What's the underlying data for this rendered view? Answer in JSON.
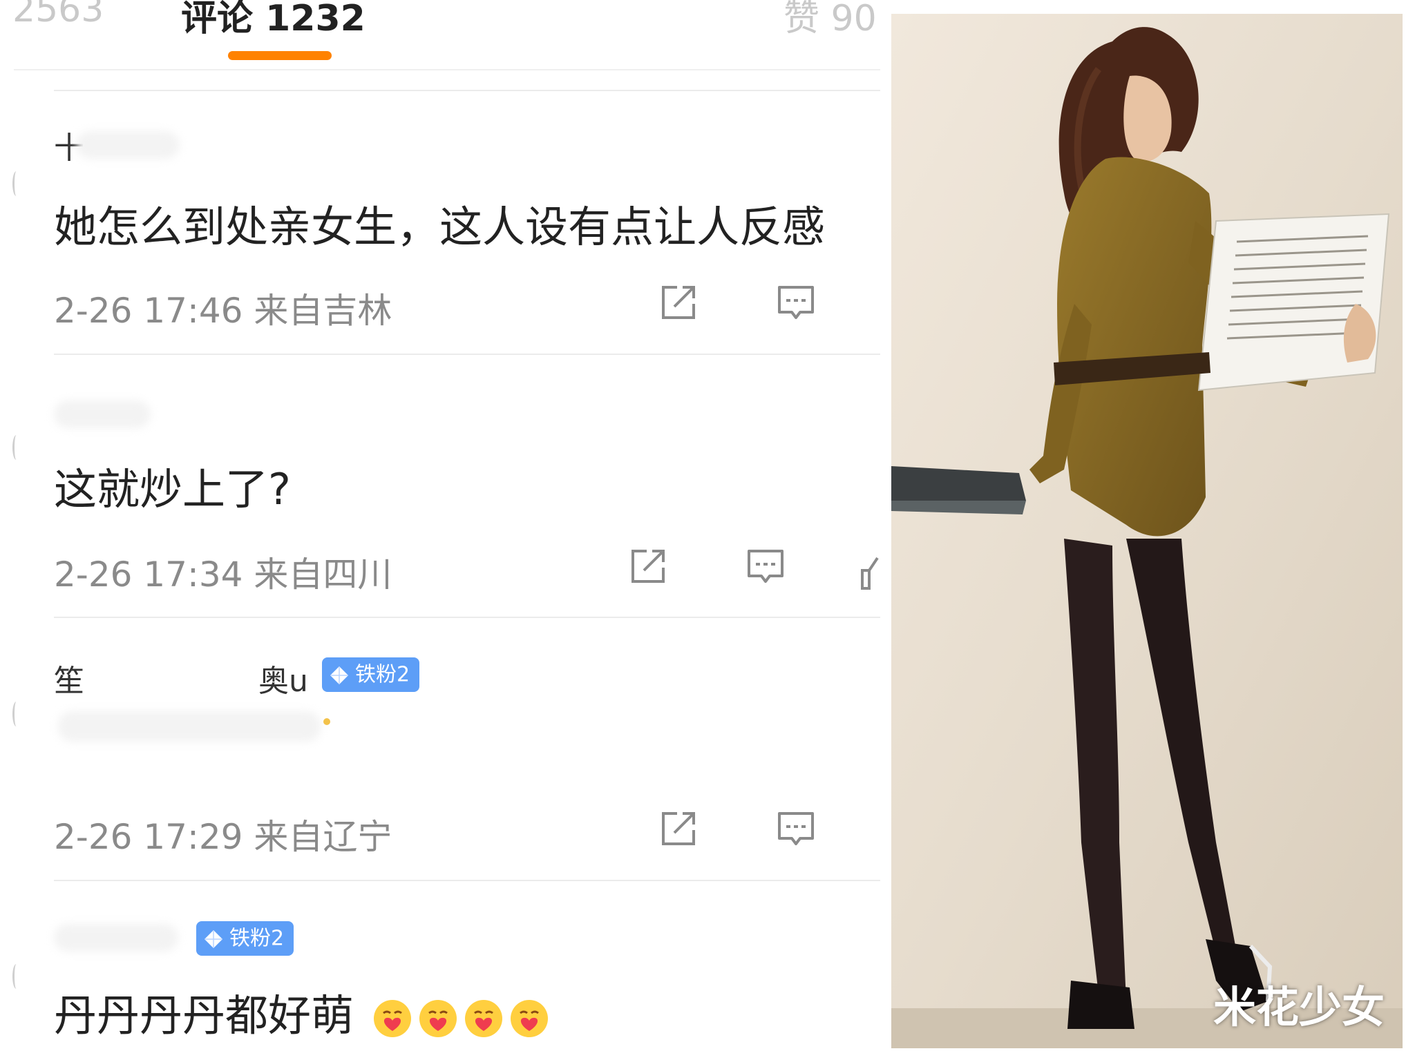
{
  "tabs": {
    "left_partial": "2563",
    "comments": "评论 1232",
    "right_partial": "赞 90"
  },
  "comments": [
    {
      "name": "十",
      "text": "她怎么到处亲女生，这人设有点让人反感",
      "time": "2-26 17:46",
      "location": "来自吉林"
    },
    {
      "name": "",
      "text": "这就炒上了?",
      "time": "2-26 17:34",
      "location": "来自四川"
    },
    {
      "name_prefix": "笙",
      "name_suffix": "奥u",
      "badge": "铁粉2",
      "text": "",
      "time": "2-26 17:29",
      "location": "来自辽宁"
    },
    {
      "badge": "铁粉2",
      "text": "丹丹丹丹都好萌"
    }
  ],
  "watermark": "米花少女",
  "colors": {
    "accent": "#ff8200",
    "badge": "#5d9ef7",
    "meta_text": "#8a8a8a",
    "comment_text": "#222222"
  },
  "icons": [
    "share-icon",
    "comment-icon",
    "like-icon",
    "diamond-icon",
    "heart-hug-emoji"
  ]
}
